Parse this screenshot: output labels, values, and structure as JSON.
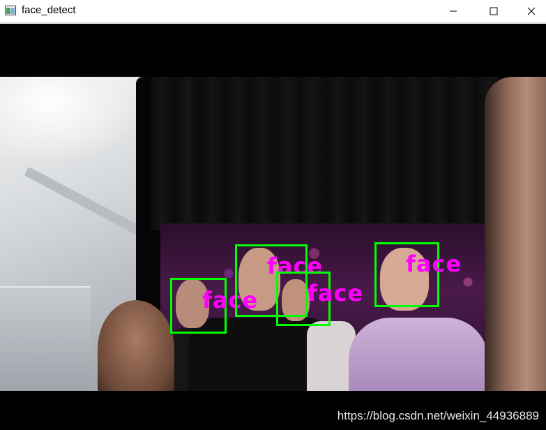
{
  "window": {
    "title": "face_detect",
    "controls": {
      "minimize": "–",
      "maximize": "☐",
      "close": "✕"
    }
  },
  "detections": [
    {
      "label": "face",
      "box_color": "#00ff00",
      "label_color": "#ff00ff"
    },
    {
      "label": "face",
      "box_color": "#00ff00",
      "label_color": "#ff00ff"
    },
    {
      "label": "face",
      "box_color": "#00ff00",
      "label_color": "#ff00ff"
    },
    {
      "label": "face",
      "box_color": "#00ff00",
      "label_color": "#ff00ff"
    }
  ],
  "watermark": "https://blog.csdn.net/weixin_44936889",
  "icons": {
    "app": "opencv-window-icon",
    "minimize": "minimize-icon",
    "maximize": "maximize-icon",
    "close": "close-icon"
  }
}
